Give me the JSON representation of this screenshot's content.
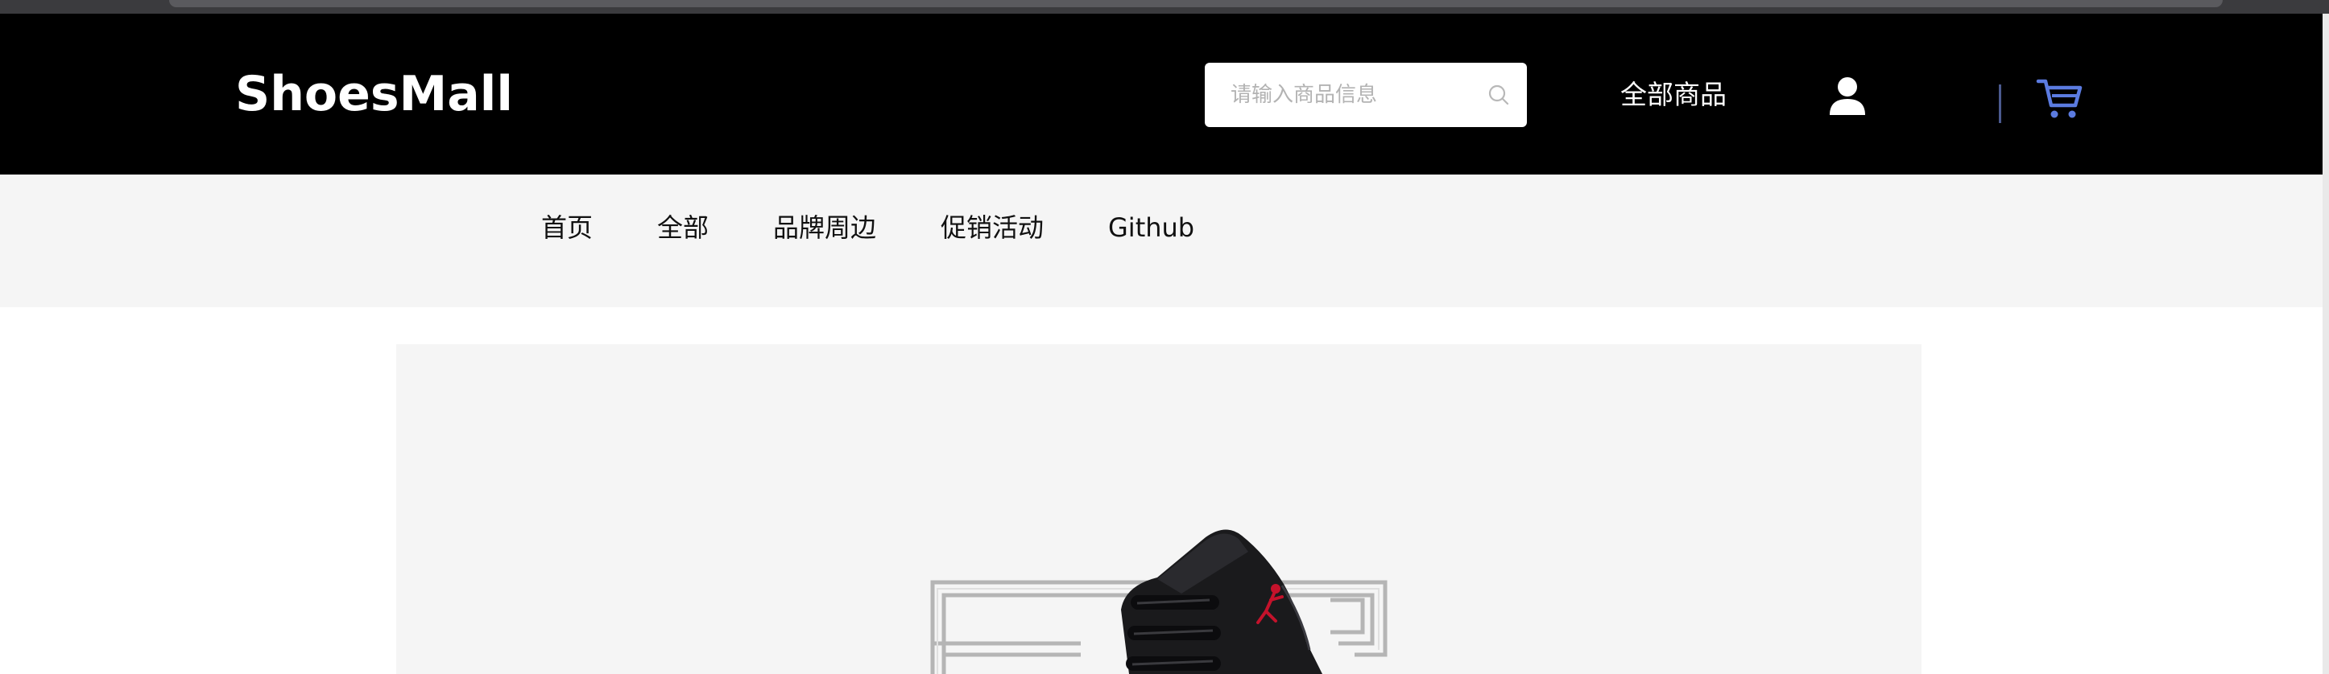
{
  "header": {
    "logo": "ShoesMall",
    "search": {
      "placeholder": "请输入商品信息",
      "value": ""
    },
    "all_goods_label": "全部商品",
    "icons": {
      "search": "search-icon",
      "user": "user-icon",
      "cart": "shopping-cart-icon"
    },
    "cart_icon_color": "#5b7be0"
  },
  "nav": {
    "items": [
      {
        "label": "首页"
      },
      {
        "label": "全部"
      },
      {
        "label": "品牌周边"
      },
      {
        "label": "促销活动"
      },
      {
        "label": "Github"
      }
    ]
  },
  "banner": {
    "image": "black-high-top-sneaker-with-red-logo"
  },
  "colors": {
    "header_bg": "#000000",
    "nav_bg": "#f5f5f5",
    "banner_bg": "#f5f5f5",
    "accent": "#5b7be0"
  }
}
